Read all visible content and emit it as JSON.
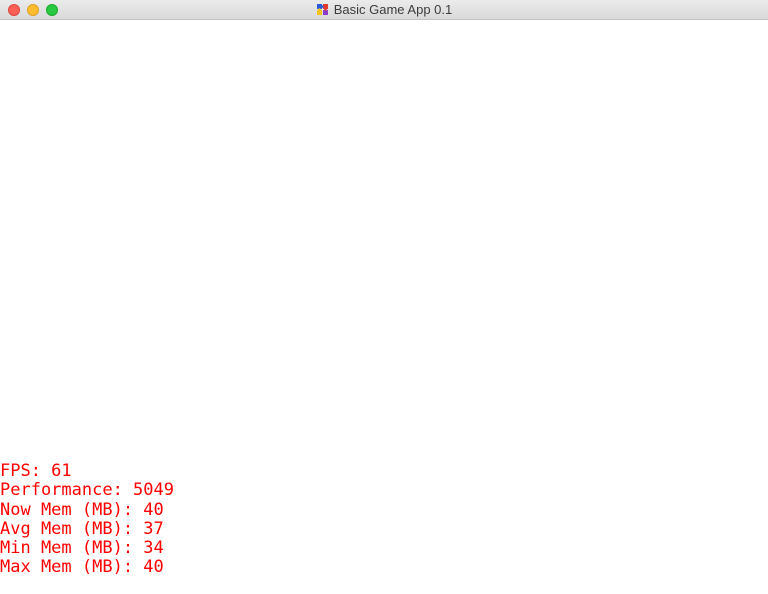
{
  "window": {
    "title": "Basic Game App 0.1",
    "icon": "puzzle-icon"
  },
  "stats": {
    "color": "#ff0000",
    "lines": [
      "FPS: 61",
      "Performance: 5049",
      "Now Mem (MB): 40",
      "Avg Mem (MB): 37",
      "Min Mem (MB): 34",
      "Max Mem (MB): 40"
    ]
  }
}
